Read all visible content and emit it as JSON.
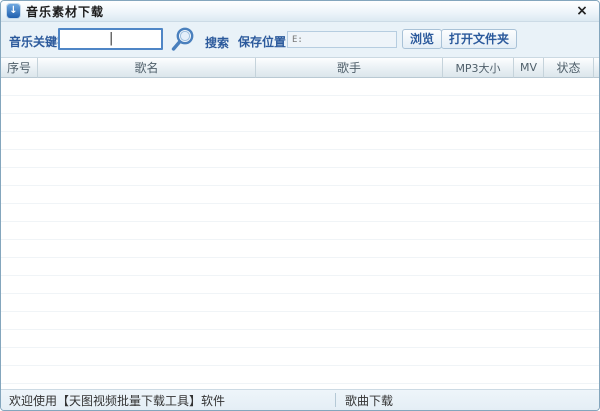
{
  "window": {
    "title": "音乐素材下载",
    "close_glyph": "×"
  },
  "icons": {
    "title_icon": "download-arrow",
    "title_icon_glyph": "↓",
    "search_icon": "magnifier",
    "caret_glyph": "|"
  },
  "toolbar": {
    "keyword_label": "音乐关键字:",
    "keyword_value": "",
    "search_label": "搜索",
    "save_location_label": "保存位置:",
    "save_location_value": "E:",
    "browse_button_label": "浏览",
    "open_folder_button_label": "打开文件夹"
  },
  "table": {
    "columns": [
      {
        "label": "序号"
      },
      {
        "label": "歌名"
      },
      {
        "label": "歌手"
      },
      {
        "label": "MP3大小"
      },
      {
        "label": "MV"
      },
      {
        "label": "状态"
      }
    ],
    "rows": []
  },
  "statusbar": {
    "welcome_text": "欢迎使用【天图视频批量下载工具】软件",
    "section_text": "歌曲下载"
  },
  "colors": {
    "accent_blue": "#2c5a9c",
    "window_bg": "#e9f2f8",
    "input_border": "#4f86c6"
  }
}
